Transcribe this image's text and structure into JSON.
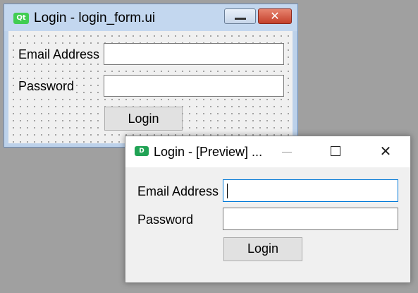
{
  "designer_window": {
    "app_badge": "Qt",
    "title": "Login - login_form.ui",
    "icons": {
      "minimize": "minimize-icon",
      "close": "close-icon"
    },
    "form": {
      "email_label": "Email Address",
      "email_value": "",
      "password_label": "Password",
      "password_value": "",
      "login_button": "Login"
    }
  },
  "preview_window": {
    "app_badge": "D",
    "title": "Login - [Preview] ...",
    "icons": {
      "minimize": "minimize-icon",
      "maximize": "maximize-icon",
      "close": "close-icon"
    },
    "form": {
      "email_label": "Email Address",
      "email_value": "",
      "password_label": "Password",
      "password_value": "",
      "login_button": "Login"
    }
  },
  "colors": {
    "desktop_background": "#a0a0a0",
    "designer_titlebar": "#c3d7ef",
    "designer_close_button": "#c4402b",
    "qt_badge": "#41cd52",
    "preview_badge": "#21a355",
    "focus_border": "#0078d7"
  }
}
